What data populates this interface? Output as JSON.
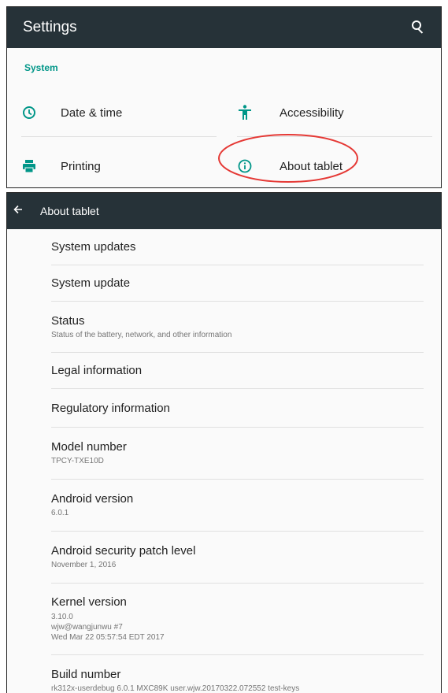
{
  "settings": {
    "title": "Settings",
    "section": "System",
    "items": [
      {
        "label": "Date & time",
        "icon": "clock-icon"
      },
      {
        "label": "Accessibility",
        "icon": "accessibility-icon"
      },
      {
        "label": "Printing",
        "icon": "printer-icon"
      },
      {
        "label": "About tablet",
        "icon": "info-icon"
      }
    ],
    "highlight_color": "#e53935"
  },
  "about": {
    "title": "About tablet",
    "items": [
      {
        "title": "System updates"
      },
      {
        "title": "System update"
      },
      {
        "title": "Status",
        "subtitle": "Status of the battery, network, and other information"
      },
      {
        "title": "Legal information"
      },
      {
        "title": "Regulatory information"
      },
      {
        "title": "Model number",
        "subtitle": "TPCY-TXE10D"
      },
      {
        "title": "Android version",
        "subtitle": "6.0.1"
      },
      {
        "title": "Android security patch level",
        "subtitle": "November 1, 2016"
      },
      {
        "title": "Kernel version",
        "lines": [
          "3.10.0",
          "wjw@wangjunwu #7",
          "Wed Mar 22 05:57:54 EDT 2017"
        ]
      },
      {
        "title": "Build number",
        "subtitle": "rk312x-userdebug 6.0.1 MXC89K user.wjw.20170322.072552 test-keys"
      }
    ]
  },
  "colors": {
    "toolbar": "#263238",
    "accent": "#009688"
  }
}
